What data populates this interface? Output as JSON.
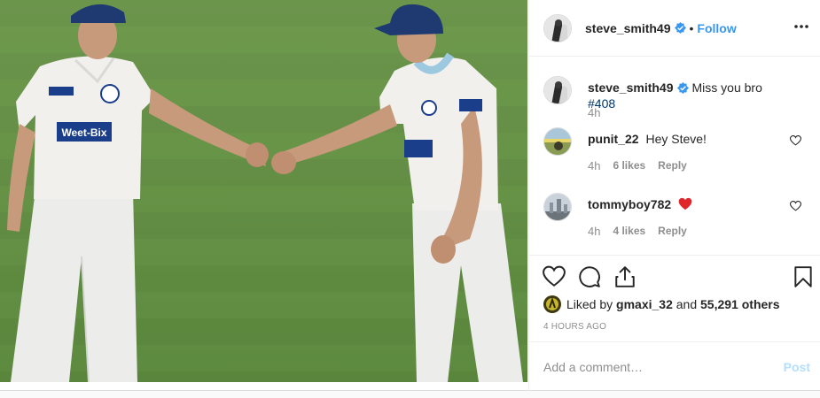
{
  "post": {
    "author": "steve_smith49",
    "follow_label": "Follow",
    "separator": "•",
    "caption": {
      "username": "steve_smith49",
      "text": "Miss you bro",
      "hashtag": "#408",
      "time": "4h"
    },
    "comments": [
      {
        "username": "punit_22",
        "text": "Hey Steve!",
        "time": "4h",
        "likes": "6 likes",
        "reply": "Reply"
      },
      {
        "username": "tommyboy782",
        "text": "",
        "emoji": "red-heart",
        "time": "4h",
        "likes": "4 likes",
        "reply": "Reply"
      }
    ],
    "liked_by": {
      "prefix": "Liked by",
      "user": "gmaxi_32",
      "and": "and",
      "others": "55,291 others"
    },
    "timestamp": "4 HOURS AGO",
    "add_comment": {
      "placeholder": "Add a comment…",
      "post_label": "Post"
    },
    "photo": {
      "jersey_logo": "Weet-Bix"
    }
  },
  "colors": {
    "link_blue": "#3897f0",
    "hashtag_blue": "#003569",
    "muted": "#8e8e8e",
    "post_disabled": "#b2dffc",
    "heart_red": "#ed4956"
  },
  "icons": [
    "verified-badge-icon",
    "more-options-icon",
    "heart-icon",
    "comment-icon",
    "share-icon",
    "bookmark-icon",
    "small-heart-icon"
  ]
}
